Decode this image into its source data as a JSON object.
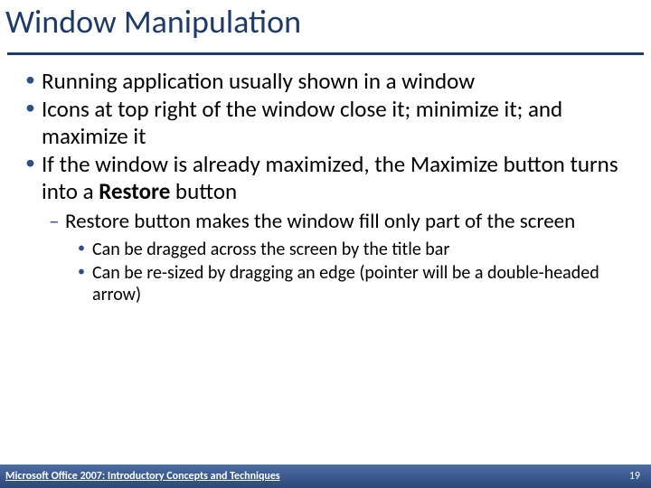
{
  "title": "Window Manipulation",
  "bullets": {
    "b1": "Running application usually shown in a window",
    "b2": "Icons at top right of the window close it; minimize it; and maximize it",
    "b3_pre": "If the window is already maximized, the Maximize button turns into a ",
    "b3_bold": "Restore",
    "b3_post": " button",
    "b3_sub1": "Restore button makes the window fill only part of the screen",
    "b3_sub1_a": "Can be dragged across the screen by the title bar",
    "b3_sub1_b": "Can be re-sized by dragging an edge (pointer will be a double-headed arrow)"
  },
  "footer": {
    "source": "Microsoft Office 2007: Introductory Concepts and Techniques",
    "page": "19"
  }
}
